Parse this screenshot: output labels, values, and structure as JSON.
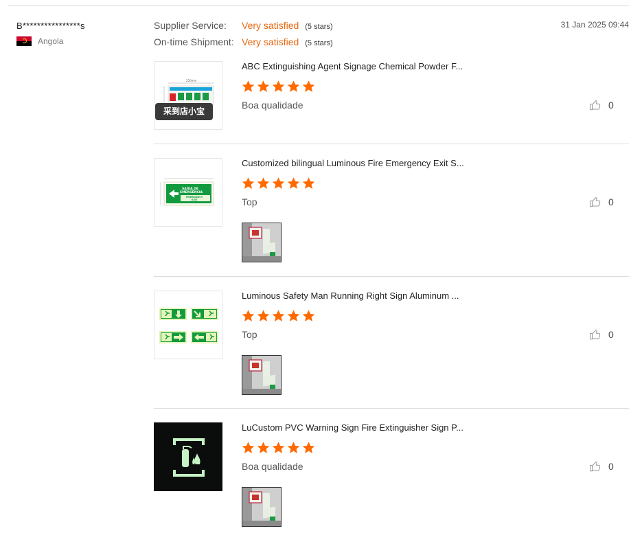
{
  "reviewer": {
    "name": "B****************s",
    "country": "Angola",
    "flag_icon": "angola-flag-icon"
  },
  "ratings": [
    {
      "label": "Supplier Service:",
      "value": "Very satisfied",
      "stars": "(5 stars)"
    },
    {
      "label": "On-time Shipment:",
      "value": "Very satisfied",
      "stars": "(5 stars)"
    }
  ],
  "date": "31 Jan 2025 09:44",
  "colors": {
    "accent": "#e8670f",
    "star": "#ff6a00"
  },
  "products": [
    {
      "title": "ABC Extinguishing Agent Signage Chemical Powder F...",
      "rating": 5,
      "review": "Boa qualidade",
      "likes": "0",
      "badge": "采到店小宝",
      "has_attachment": false
    },
    {
      "title": "Customized bilingual Luminous Fire Emergency Exit S...",
      "rating": 5,
      "review": "Top",
      "likes": "0",
      "has_attachment": true
    },
    {
      "title": "Luminous Safety Man Running Right Sign Aluminum ...",
      "rating": 5,
      "review": "Top",
      "likes": "0",
      "has_attachment": true
    },
    {
      "title": "LuCustom PVC Warning Sign Fire Extinguisher Sign P...",
      "rating": 5,
      "review": "Boa qualidade",
      "likes": "0",
      "has_attachment": true
    }
  ]
}
